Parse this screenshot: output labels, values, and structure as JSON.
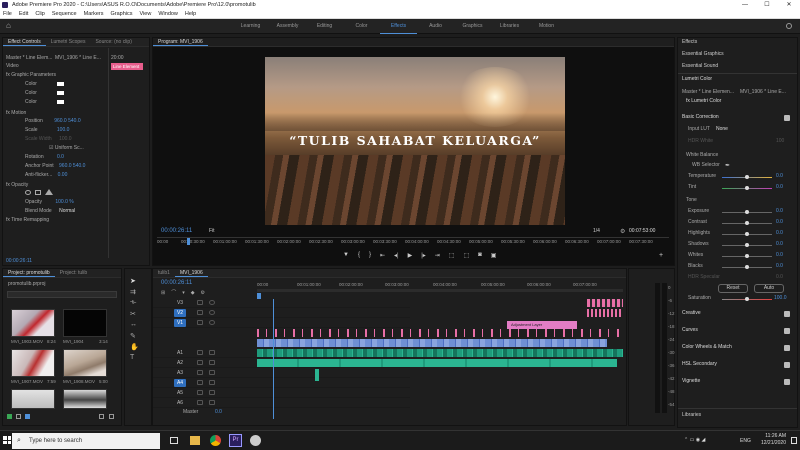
{
  "window": {
    "title": "Adobe Premiere Pro 2020 - C:\\Users\\ASUS R.O.O\\Documents\\Adobe\\Premiere Pro\\12.0\\promotulib",
    "minimize": "—",
    "maximize": "☐",
    "close": "✕"
  },
  "menu": [
    "File",
    "Edit",
    "Clip",
    "Sequence",
    "Markers",
    "Graphics",
    "View",
    "Window",
    "Help"
  ],
  "workspaces": [
    "Learning",
    "Assembly",
    "Editing",
    "Color",
    "Effects",
    "Audio",
    "Graphics",
    "Libraries",
    "Motion"
  ],
  "workspace_active": "Effects",
  "effect_controls": {
    "tabs": [
      "Effect Controls",
      "Lumetri Scopes",
      "Source: (no clip)"
    ],
    "master": "Master * Line Elem...",
    "seq": "MVI_1906 * Line E...",
    "video_label": "Video",
    "timecode_right": "20:00",
    "clip_label": "Line Element",
    "rows": [
      {
        "label": "fx  Graphic Parameters",
        "value": ""
      },
      {
        "label": "Color",
        "value": ""
      },
      {
        "label": "Color",
        "value": ""
      },
      {
        "label": "Color",
        "value": ""
      },
      {
        "label": "fx  Motion",
        "value": ""
      },
      {
        "label": "Position",
        "value": "960.0    540.0"
      },
      {
        "label": "Scale",
        "value": "100.0"
      },
      {
        "label": "Scale Width",
        "value": "100.0"
      },
      {
        "label": "☑ Uniform Sc...",
        "value": ""
      },
      {
        "label": "Rotation",
        "value": "0.0"
      },
      {
        "label": "Anchor Point",
        "value": "960.0   540.0"
      },
      {
        "label": "Anti-flicker...",
        "value": "0.00"
      },
      {
        "label": "fx  Opacity",
        "value": ""
      },
      {
        "label": "Opacity",
        "value": "100.0 %"
      },
      {
        "label": "Blend Mode",
        "value": "Normal"
      },
      {
        "label": "fx  Time Remapping",
        "value": ""
      }
    ],
    "bottom_tc": "00:00:26:11"
  },
  "project": {
    "tabs": [
      "Project: promotulib",
      "Project: tulib"
    ],
    "file": "promotulib.prproj",
    "items": [
      {
        "name": "MVI_1903.MOV",
        "dur": "8:24"
      },
      {
        "name": "MVI_1904",
        "dur": "3:14"
      },
      {
        "name": "MVI_1907.MOV",
        "dur": "7:59"
      },
      {
        "name": "MVI_1908.MOV",
        "dur": "5:00"
      }
    ]
  },
  "program": {
    "tab": "Program: MVI_1906",
    "caption": "“TULIB SAHABAT KELUARGA”",
    "tc_left": "00:00:26:11",
    "fit": "Fit",
    "quality": "1/4",
    "tc_right": "00:07:53:00",
    "ruler": [
      "00:00",
      "00:00:30:00",
      "00:01:00:00",
      "00:01:30:00",
      "00:02:00:00",
      "00:02:30:00",
      "00:03:00:00",
      "00:03:30:00",
      "00:04:00:00",
      "00:04:30:00",
      "00:05:00:00",
      "00:05:30:00",
      "00:06:00:00",
      "00:06:30:00",
      "00:07:00:00",
      "00:07:30:00"
    ]
  },
  "timeline": {
    "tabs": [
      "tulib1",
      "MVI_1906"
    ],
    "tc": "00:00:26:11",
    "ruler": [
      "00:00",
      "00:01:00:00",
      "00:02:00:00",
      "00:03:00:00",
      "00:04:00:00",
      "00:05:00:00",
      "00:06:00:00",
      "00:07:00:00"
    ],
    "tracks": [
      "V3",
      "V2",
      "V1",
      "A1",
      "A2",
      "A3",
      "A4",
      "A5",
      "A6"
    ],
    "master": "Master",
    "master_val": "0.0",
    "clip_labels": [
      "Adjust",
      "Adjustment Layer"
    ],
    "meter_scale": [
      "0",
      "-6",
      "-12",
      "-18",
      "-24",
      "-30",
      "-36",
      "-42",
      "-48",
      "-54"
    ]
  },
  "lumetri": {
    "tabs": [
      "Effects",
      "Essential Graphics",
      "Essential Sound",
      "Lumetri Color"
    ],
    "master": "Master * Line Elemen...",
    "seq": "MVI_1906 * Line E...",
    "effect": "fx  Lumetri Color",
    "basic": "Basic Correction",
    "input_lut": "Input LUT",
    "lut_val": "None",
    "hdr": "HDR White",
    "hdr_val": "100",
    "wb": "White Balance",
    "wb_sel": "WB Selector",
    "rows": [
      {
        "label": "Temperature",
        "value": "0.0"
      },
      {
        "label": "Tint",
        "value": "0.0"
      },
      {
        "label": "Tone",
        "value": ""
      },
      {
        "label": "Exposure",
        "value": "0.0"
      },
      {
        "label": "Contrast",
        "value": "0.0"
      },
      {
        "label": "Highlights",
        "value": "0.0"
      },
      {
        "label": "Shadows",
        "value": "0.0"
      },
      {
        "label": "Whites",
        "value": "0.0"
      },
      {
        "label": "Blacks",
        "value": "0.0"
      },
      {
        "label": "HDR Specular",
        "value": "0.0"
      }
    ],
    "reset": "Reset",
    "auto": "Auto",
    "saturation": "Saturation",
    "sat_val": "100.0",
    "sections": [
      "Creative",
      "Curves",
      "Color Wheels & Match",
      "HSL Secondary",
      "Vignette"
    ],
    "libraries": "Libraries"
  },
  "taskbar": {
    "search": "Type here to search",
    "time": "11:26 AM",
    "date": "12/21/2020",
    "lang": "ENG"
  }
}
